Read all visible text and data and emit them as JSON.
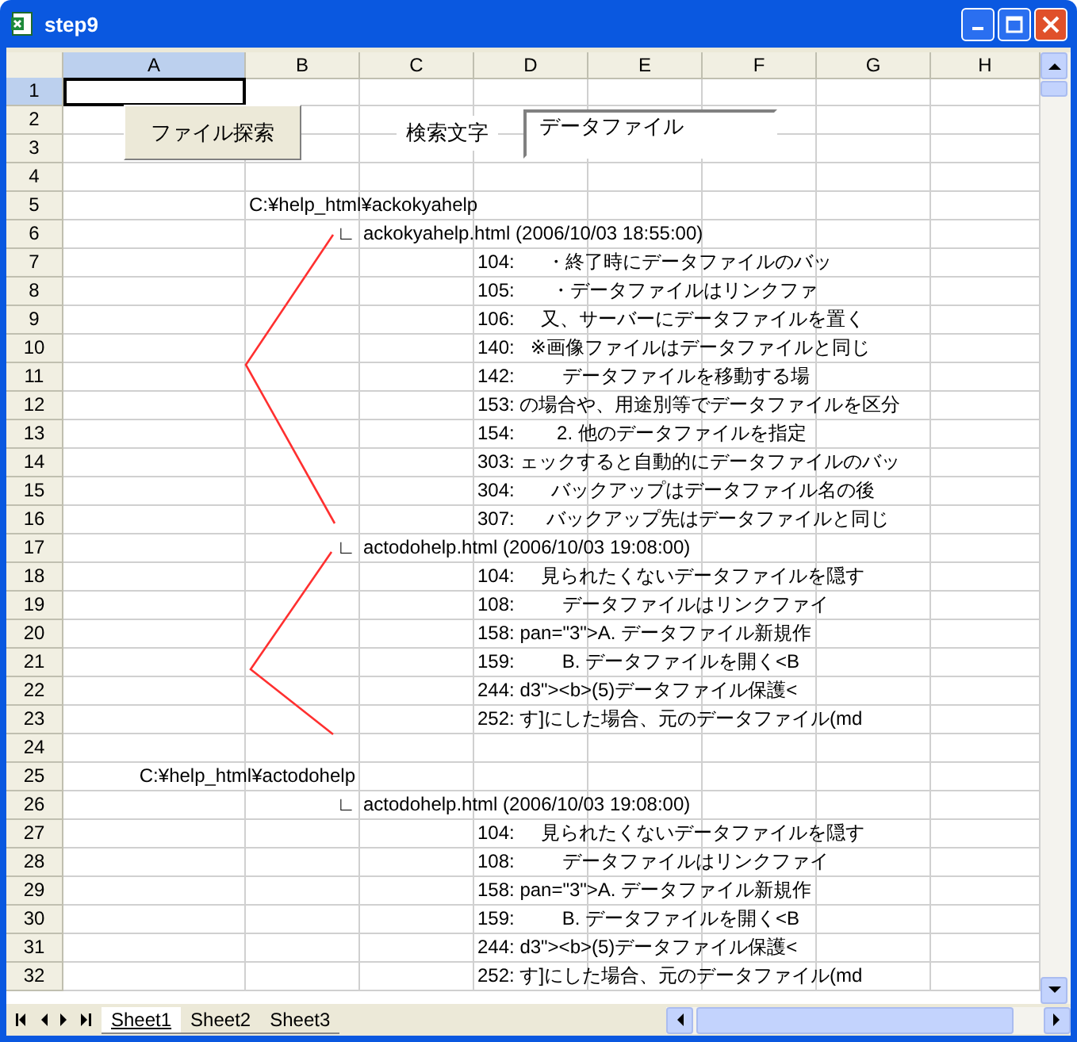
{
  "window": {
    "title": "step9"
  },
  "columns": [
    {
      "label": "A",
      "selected": true
    },
    {
      "label": "B",
      "selected": false
    },
    {
      "label": "C",
      "selected": false
    },
    {
      "label": "D",
      "selected": false
    },
    {
      "label": "E",
      "selected": false
    },
    {
      "label": "F",
      "selected": false
    },
    {
      "label": "G",
      "selected": false
    },
    {
      "label": "H",
      "selected": false
    }
  ],
  "search_button": {
    "label": "ファイル探索"
  },
  "search_label": "検索文字",
  "search_field": {
    "value": "データファイル"
  },
  "rows": [
    {
      "number": "1",
      "selected": true,
      "cells": {}
    },
    {
      "number": "2",
      "selected": false,
      "cells": {}
    },
    {
      "number": "3",
      "selected": false,
      "cells": {}
    },
    {
      "number": "4",
      "selected": false,
      "cells": {}
    },
    {
      "number": "5",
      "selected": false,
      "cells": {
        "b": {
          "text": "C:¥help_html¥ackokyahelp",
          "right_aligned": false
        }
      }
    },
    {
      "number": "6",
      "selected": false,
      "cells": {
        "b": {
          "text": "∟",
          "right_aligned": true
        },
        "c": {
          "text": "ackokyahelp.html (2006/10/03 18:55:00)",
          "right_aligned": false
        }
      }
    },
    {
      "number": "7",
      "selected": false,
      "cells": {
        "d": {
          "text": "104:      ・終了時にデータファイルのバッ",
          "right_aligned": false
        }
      }
    },
    {
      "number": "8",
      "selected": false,
      "cells": {
        "d": {
          "text": "105:       ・データファイルはリンクファ",
          "right_aligned": false
        }
      }
    },
    {
      "number": "9",
      "selected": false,
      "cells": {
        "d": {
          "text": "106:     又、サーバーにデータファイルを置く",
          "right_aligned": false
        }
      }
    },
    {
      "number": "10",
      "selected": false,
      "cells": {
        "d": {
          "text": "140:   ※画像ファイルはデータファイルと同じ",
          "right_aligned": false
        }
      }
    },
    {
      "number": "11",
      "selected": false,
      "cells": {
        "d": {
          "text": "142:         データファイルを移動する場",
          "right_aligned": false
        }
      }
    },
    {
      "number": "12",
      "selected": false,
      "cells": {
        "d": {
          "text": "153: の場合や、用途別等でデータファイルを区分",
          "right_aligned": false
        }
      }
    },
    {
      "number": "13",
      "selected": false,
      "cells": {
        "d": {
          "text": "154:        2. 他のデータファイルを指定",
          "right_aligned": false
        }
      }
    },
    {
      "number": "14",
      "selected": false,
      "cells": {
        "d": {
          "text": "303: ェックすると自動的にデータファイルのバッ",
          "right_aligned": false
        }
      }
    },
    {
      "number": "15",
      "selected": false,
      "cells": {
        "d": {
          "text": "304:       バックアップはデータファイル名の後",
          "right_aligned": false
        }
      }
    },
    {
      "number": "16",
      "selected": false,
      "cells": {
        "d": {
          "text": "307:      バックアップ先はデータファイルと同じ",
          "right_aligned": false
        }
      }
    },
    {
      "number": "17",
      "selected": false,
      "cells": {
        "b": {
          "text": "∟",
          "right_aligned": true
        },
        "c": {
          "text": "actodohelp.html (2006/10/03 19:08:00)",
          "right_aligned": false
        }
      }
    },
    {
      "number": "18",
      "selected": false,
      "cells": {
        "d": {
          "text": "104:     見られたくないデータファイルを隠す",
          "right_aligned": false
        }
      }
    },
    {
      "number": "19",
      "selected": false,
      "cells": {
        "d": {
          "text": "108:         データファイルはリンクファイ",
          "right_aligned": false
        }
      }
    },
    {
      "number": "20",
      "selected": false,
      "cells": {
        "d": {
          "text": "158: pan=\"3\">A. データファイル新規作",
          "right_aligned": false
        }
      }
    },
    {
      "number": "21",
      "selected": false,
      "cells": {
        "d": {
          "text": "159:         B. データファイルを開く<B",
          "right_aligned": false
        }
      }
    },
    {
      "number": "22",
      "selected": false,
      "cells": {
        "d": {
          "text": "244: d3\"><b>(5)データファイル保護<",
          "right_aligned": false
        }
      }
    },
    {
      "number": "23",
      "selected": false,
      "cells": {
        "d": {
          "text": "252: す]にした場合、元のデータファイル(md",
          "right_aligned": false
        }
      }
    },
    {
      "number": "24",
      "selected": false,
      "cells": {}
    },
    {
      "number": "25",
      "selected": false,
      "cells": {
        "b": {
          "text": "C:¥help_html¥actodohelp",
          "right_aligned": true
        }
      }
    },
    {
      "number": "26",
      "selected": false,
      "cells": {
        "b": {
          "text": "∟",
          "right_aligned": true
        },
        "c": {
          "text": "actodohelp.html (2006/10/03 19:08:00)",
          "right_aligned": false
        }
      }
    },
    {
      "number": "27",
      "selected": false,
      "cells": {
        "d": {
          "text": "104:     見られたくないデータファイルを隠す",
          "right_aligned": false
        }
      }
    },
    {
      "number": "28",
      "selected": false,
      "cells": {
        "d": {
          "text": "108:         データファイルはリンクファイ",
          "right_aligned": false
        }
      }
    },
    {
      "number": "29",
      "selected": false,
      "cells": {
        "d": {
          "text": "158: pan=\"3\">A. データファイル新規作",
          "right_aligned": false
        }
      }
    },
    {
      "number": "30",
      "selected": false,
      "cells": {
        "d": {
          "text": "159:         B. データファイルを開く<B",
          "right_aligned": false
        }
      }
    },
    {
      "number": "31",
      "selected": false,
      "cells": {
        "d": {
          "text": "244: d3\"><b>(5)データファイル保護<",
          "right_aligned": false
        }
      }
    },
    {
      "number": "32",
      "selected": false,
      "cells": {
        "d": {
          "text": "252: す]にした場合、元のデータファイル(md",
          "right_aligned": false
        }
      }
    }
  ],
  "sheet_tabs": [
    {
      "label": "Sheet1",
      "selected": true
    },
    {
      "label": "Sheet2",
      "selected": false
    },
    {
      "label": "Sheet3",
      "selected": false
    }
  ]
}
